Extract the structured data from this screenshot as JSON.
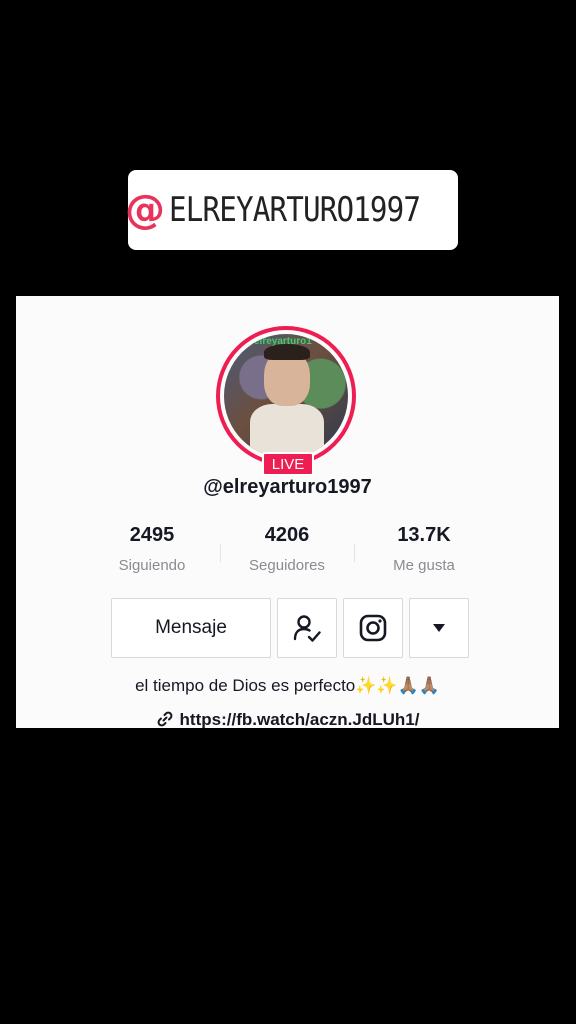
{
  "banner": {
    "at_symbol": "@",
    "handle": "ELREYARTURO1997"
  },
  "profile": {
    "avatar_overlay_text": "elreyarturo1",
    "live_badge": "LIVE",
    "username": "@elreyarturo1997",
    "stats": [
      {
        "value": "2495",
        "label": "Siguiendo"
      },
      {
        "value": "4206",
        "label": "Seguidores"
      },
      {
        "value": "13.7K",
        "label": "Me gusta"
      }
    ],
    "buttons": {
      "message_label": "Mensaje",
      "follow_icon": "user-check-icon",
      "instagram_icon": "instagram-icon",
      "dropdown_icon": "caret-down-icon"
    },
    "bio": {
      "text": "el tiempo de Dios es perfecto",
      "emojis": "✨✨🙏🏽🙏🏽"
    },
    "link": "https://fb.watch/aczn.JdLUh1/"
  },
  "colors": {
    "accent": "#ee1d52",
    "banner_at": "#e8345c",
    "background": "#000000"
  }
}
